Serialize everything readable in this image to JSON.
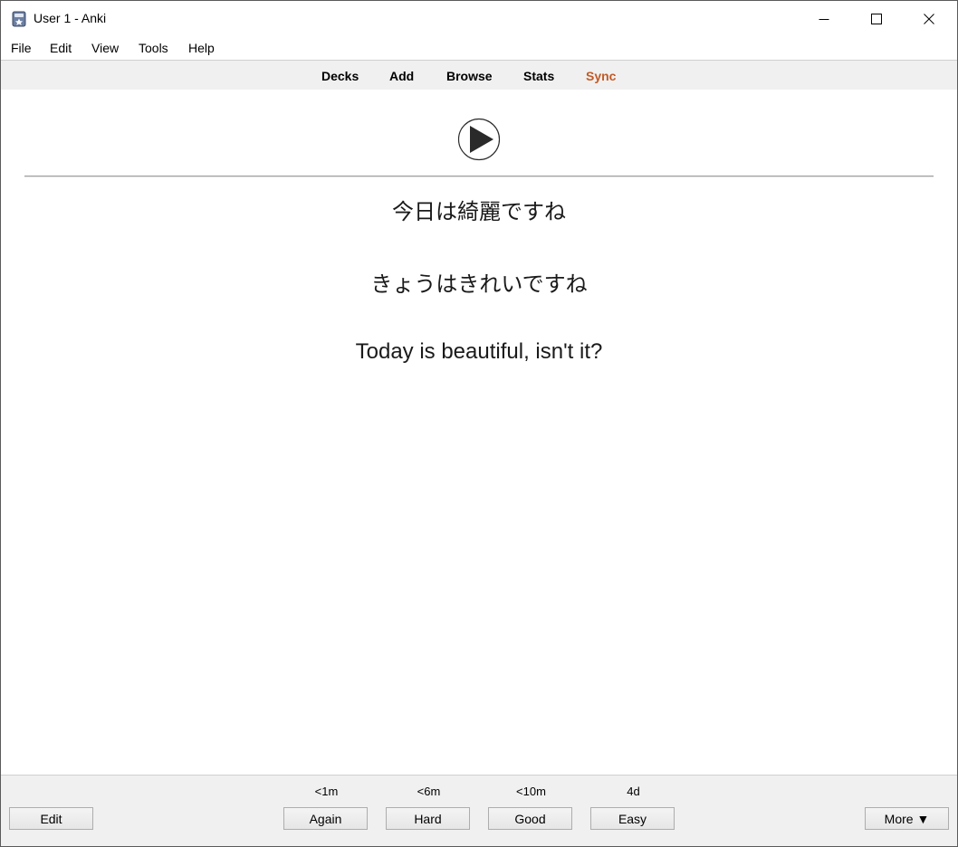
{
  "window": {
    "title": "User 1 - Anki",
    "minimize_icon": "minimize-icon",
    "maximize_icon": "maximize-icon",
    "close_icon": "close-icon"
  },
  "menu": {
    "items": [
      {
        "label": "File"
      },
      {
        "label": "Edit"
      },
      {
        "label": "View"
      },
      {
        "label": "Tools"
      },
      {
        "label": "Help"
      }
    ]
  },
  "toolbar": {
    "items": [
      {
        "label": "Decks"
      },
      {
        "label": "Add"
      },
      {
        "label": "Browse"
      },
      {
        "label": "Stats"
      },
      {
        "label": "Sync"
      }
    ],
    "sync_color": "#c15a26"
  },
  "card": {
    "play_icon": "play-icon",
    "kanji": "今日は綺麗ですね",
    "kana": "きょうはきれいですね",
    "english": "Today is beautiful, isn't it?"
  },
  "bottom": {
    "edit_label": "Edit",
    "more_label": "More ▼",
    "answers": [
      {
        "interval": "<1m",
        "label": "Again"
      },
      {
        "interval": "<6m",
        "label": "Hard"
      },
      {
        "interval": "<10m",
        "label": "Good"
      },
      {
        "interval": "4d",
        "label": "Easy"
      }
    ]
  }
}
